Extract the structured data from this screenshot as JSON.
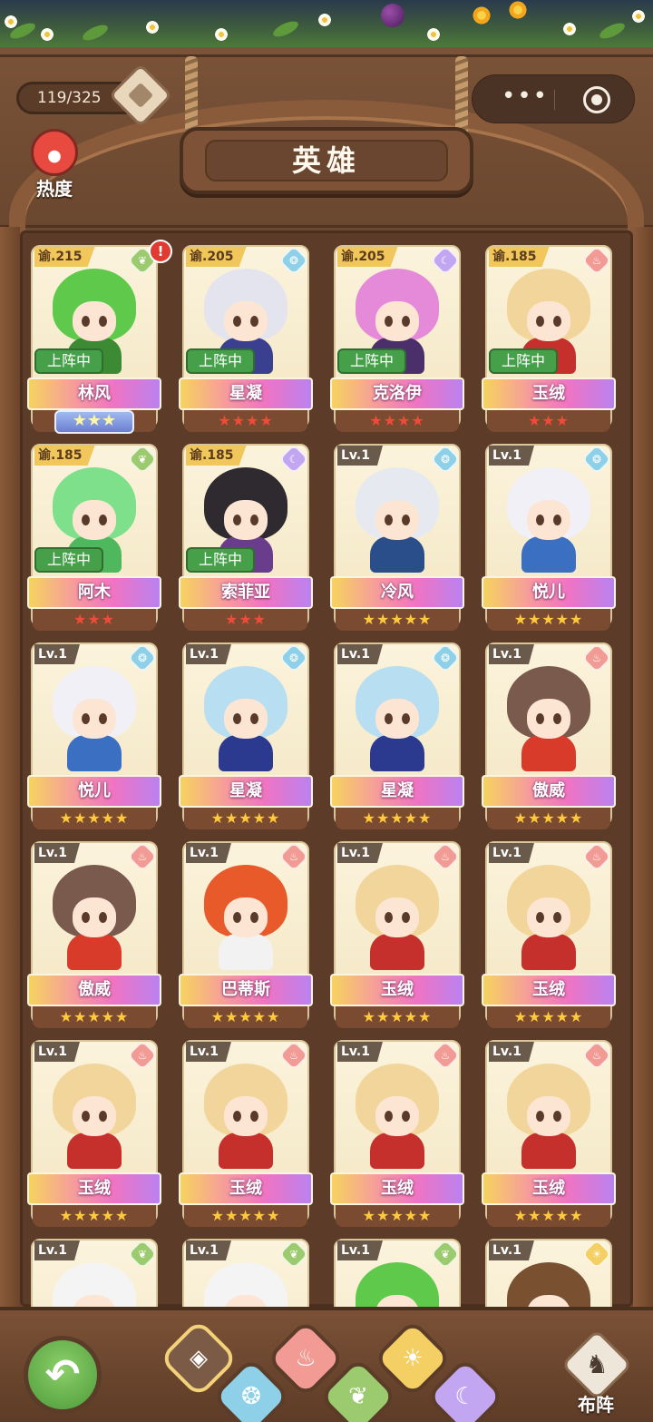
{
  "header": {
    "title": "英雄",
    "counter": "119/325",
    "heat_label": "热度",
    "menu_dots": "•••"
  },
  "heroes": [
    {
      "level": "谕.215",
      "level_style": "yu",
      "element": "wood",
      "name": "林风",
      "deployed": "上阵中",
      "stars": "★★★",
      "star_color": "rank",
      "alert": "!",
      "hair": "#5ec94a",
      "outfit": "#3d8a34"
    },
    {
      "level": "谕.205",
      "level_style": "yu",
      "element": "water",
      "name": "星凝",
      "deployed": "上阵中",
      "stars": "★★★★",
      "star_color": "red",
      "hair": "#e4e4ee",
      "outfit": "#3a3f8f"
    },
    {
      "level": "谕.205",
      "level_style": "yu",
      "element": "moon",
      "name": "克洛伊",
      "deployed": "上阵中",
      "stars": "★★★★",
      "star_color": "red",
      "hair": "#e58ad8",
      "outfit": "#4a2f6a"
    },
    {
      "level": "谕.185",
      "level_style": "yu",
      "element": "fire",
      "name": "玉绒",
      "deployed": "上阵中",
      "stars": "★★★",
      "star_color": "red",
      "hair": "#f2d59a",
      "outfit": "#c6302c"
    },
    {
      "level": "谕.185",
      "level_style": "yu",
      "element": "wood",
      "name": "阿木",
      "deployed": "上阵中",
      "stars": "★★★",
      "star_color": "red",
      "hair": "#7ee08a",
      "outfit": "#4fb85e"
    },
    {
      "level": "谕.185",
      "level_style": "yu",
      "element": "moon",
      "name": "索菲亚",
      "deployed": "上阵中",
      "stars": "★★★",
      "star_color": "red",
      "hair": "#2e2a30",
      "outfit": "#6a3d8c"
    },
    {
      "level": "Lv.1",
      "level_style": "lv",
      "element": "water",
      "name": "冷风",
      "deployed": "",
      "stars": "★★★★★",
      "star_color": "gold",
      "hair": "#e6eaf0",
      "outfit": "#2a4e8a"
    },
    {
      "level": "Lv.1",
      "level_style": "lv",
      "element": "water",
      "name": "悦儿",
      "deployed": "",
      "stars": "★★★★★",
      "star_color": "gold",
      "hair": "#f0f0f6",
      "outfit": "#3b6fc2"
    },
    {
      "level": "Lv.1",
      "level_style": "lv",
      "element": "water",
      "name": "悦儿",
      "deployed": "",
      "stars": "★★★★★",
      "star_color": "gold",
      "hair": "#f0f0f6",
      "outfit": "#3b6fc2"
    },
    {
      "level": "Lv.1",
      "level_style": "lv",
      "element": "water",
      "name": "星凝",
      "deployed": "",
      "stars": "★★★★★",
      "star_color": "gold",
      "hair": "#b8def2",
      "outfit": "#2b3a8f"
    },
    {
      "level": "Lv.1",
      "level_style": "lv",
      "element": "water",
      "name": "星凝",
      "deployed": "",
      "stars": "★★★★★",
      "star_color": "gold",
      "hair": "#b8def2",
      "outfit": "#2b3a8f"
    },
    {
      "level": "Lv.1",
      "level_style": "lv",
      "element": "fire",
      "name": "傲威",
      "deployed": "",
      "stars": "★★★★★",
      "star_color": "gold",
      "hair": "#7a5a4c",
      "outfit": "#d83b2a"
    },
    {
      "level": "Lv.1",
      "level_style": "lv",
      "element": "fire",
      "name": "傲威",
      "deployed": "",
      "stars": "★★★★★",
      "star_color": "gold",
      "hair": "#7a5a4c",
      "outfit": "#d83b2a"
    },
    {
      "level": "Lv.1",
      "level_style": "lv",
      "element": "fire",
      "name": "巴蒂斯",
      "deployed": "",
      "stars": "★★★★★",
      "star_color": "gold",
      "hair": "#e85a2a",
      "outfit": "#f2f2f2"
    },
    {
      "level": "Lv.1",
      "level_style": "lv",
      "element": "fire",
      "name": "玉绒",
      "deployed": "",
      "stars": "★★★★★",
      "star_color": "gold",
      "hair": "#f2d59a",
      "outfit": "#c6302c"
    },
    {
      "level": "Lv.1",
      "level_style": "lv",
      "element": "fire",
      "name": "玉绒",
      "deployed": "",
      "stars": "★★★★★",
      "star_color": "gold",
      "hair": "#f2d59a",
      "outfit": "#c6302c"
    },
    {
      "level": "Lv.1",
      "level_style": "lv",
      "element": "fire",
      "name": "玉绒",
      "deployed": "",
      "stars": "★★★★★",
      "star_color": "gold",
      "hair": "#f2d59a",
      "outfit": "#c6302c"
    },
    {
      "level": "Lv.1",
      "level_style": "lv",
      "element": "fire",
      "name": "玉绒",
      "deployed": "",
      "stars": "★★★★★",
      "star_color": "gold",
      "hair": "#f2d59a",
      "outfit": "#c6302c"
    },
    {
      "level": "Lv.1",
      "level_style": "lv",
      "element": "fire",
      "name": "玉绒",
      "deployed": "",
      "stars": "★★★★★",
      "star_color": "gold",
      "hair": "#f2d59a",
      "outfit": "#c6302c"
    },
    {
      "level": "Lv.1",
      "level_style": "lv",
      "element": "fire",
      "name": "玉绒",
      "deployed": "",
      "stars": "★★★★★",
      "star_color": "gold",
      "hair": "#f2d59a",
      "outfit": "#c6302c"
    },
    {
      "level": "Lv.1",
      "level_style": "lv",
      "element": "wood",
      "name": "",
      "deployed": "",
      "stars": "",
      "star_color": "gold",
      "hair": "#f4f4f4",
      "outfit": "#d9d9d9"
    },
    {
      "level": "Lv.1",
      "level_style": "lv",
      "element": "wood",
      "name": "",
      "deployed": "",
      "stars": "",
      "star_color": "gold",
      "hair": "#f4f4f4",
      "outfit": "#d9d9d9"
    },
    {
      "level": "Lv.1",
      "level_style": "lv",
      "element": "wood",
      "name": "",
      "deployed": "",
      "stars": "",
      "star_color": "gold",
      "hair": "#5ec94a",
      "outfit": "#3d8a34"
    },
    {
      "level": "Lv.1",
      "level_style": "lv",
      "element": "sun",
      "name": "",
      "deployed": "",
      "stars": "",
      "star_color": "gold",
      "hair": "#7a5130",
      "outfit": "#4a3020"
    }
  ],
  "element_icons": {
    "wood": "leaf-icon",
    "water": "water-swirl-icon",
    "fire": "flame-icon",
    "moon": "moon-icon",
    "sun": "sun-icon"
  },
  "filters": [
    {
      "id": "all",
      "icon": "grid-diamond-icon",
      "color": "#7b5b45"
    },
    {
      "id": "water",
      "icon": "water-swirl-icon",
      "color": "#8ed0e8"
    },
    {
      "id": "fire",
      "icon": "flame-icon",
      "color": "#f29a94"
    },
    {
      "id": "wood",
      "icon": "leaf-icon",
      "color": "#9ccb6f"
    },
    {
      "id": "sun",
      "icon": "sun-icon",
      "color": "#f4cf63"
    },
    {
      "id": "moon",
      "icon": "moon-icon",
      "color": "#c3a6f2"
    }
  ],
  "bottom": {
    "formation_label": "布阵"
  }
}
